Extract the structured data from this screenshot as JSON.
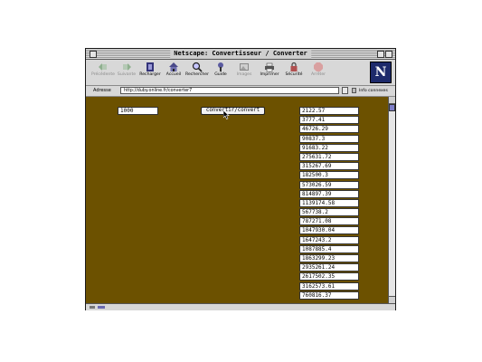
{
  "window": {
    "title": "Netscape: Convertisseur / Converter"
  },
  "toolbar": {
    "buttons": [
      {
        "label": "Précédente",
        "icon": "back-arrow-icon",
        "enabled": false
      },
      {
        "label": "Suivante",
        "icon": "forward-arrow-icon",
        "enabled": false
      },
      {
        "label": "Recharger",
        "icon": "reload-icon",
        "enabled": true
      },
      {
        "label": "Accueil",
        "icon": "home-icon",
        "enabled": true
      },
      {
        "label": "Rechercher",
        "icon": "search-icon",
        "enabled": true
      },
      {
        "label": "Guide",
        "icon": "guide-icon",
        "enabled": true
      },
      {
        "label": "Images",
        "icon": "images-icon",
        "enabled": false
      },
      {
        "label": "Imprimer",
        "icon": "print-icon",
        "enabled": true
      },
      {
        "label": "Sécurité",
        "icon": "security-lock-icon",
        "enabled": true
      },
      {
        "label": "Arrêter",
        "icon": "stop-icon",
        "enabled": false
      }
    ],
    "logo": "N"
  },
  "address": {
    "label": "Adresse",
    "url": "http://duby.online.fr/converter7",
    "info_label": "Info connexes"
  },
  "form": {
    "amount_value": "1000",
    "convert_label": "convertir/convert"
  },
  "results": [
    "2122.57",
    "3777.41",
    "46726.29",
    "90837.3",
    "91683.22",
    "275631.72",
    "315267.69",
    "182500.3",
    "573026.59",
    "814897.39",
    "1139174.58",
    "567738.2",
    "787271.08",
    "1047930.04",
    "1647243.2",
    "1087885.4",
    "1863299.23",
    "2935261.24",
    "2617502.35",
    "3162573.61",
    "760816.37"
  ],
  "colors": {
    "page_background": "#6c5100",
    "scroll_thumb": "#7e7ec8"
  }
}
